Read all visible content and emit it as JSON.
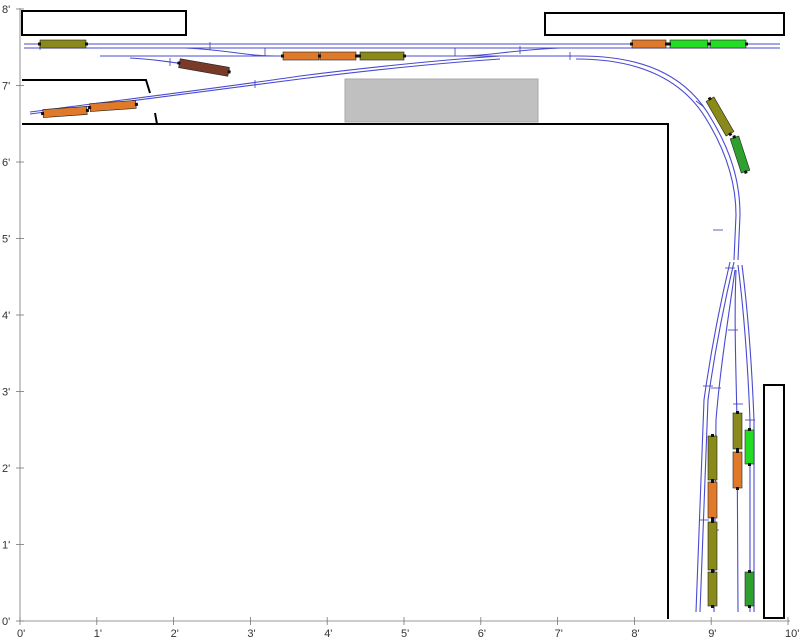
{
  "axes": {
    "x_labels": [
      "0'",
      "1'",
      "2'",
      "3'",
      "4'",
      "5'",
      "6'",
      "7'",
      "8'",
      "9'",
      "10'"
    ],
    "y_labels": [
      "0'",
      "1'",
      "2'",
      "3'",
      "4'",
      "5'",
      "6'",
      "7'",
      "8'"
    ]
  },
  "colors": {
    "track": "#4a4ad0",
    "bench": "#000000",
    "structure_fill": "#c0c0c0",
    "olive_car": "#8a8a1a",
    "orange_car": "#e07a2a",
    "green_car": "#22dd22",
    "dark_green_car": "#2ea02e",
    "brown_car": "#7a3a2a"
  },
  "rolling_stock": [
    {
      "id": "car-1",
      "kind": "olive_car"
    },
    {
      "id": "car-2",
      "kind": "brown_car"
    },
    {
      "id": "car-3",
      "kind": "orange_car"
    },
    {
      "id": "car-4",
      "kind": "orange_car"
    },
    {
      "id": "car-5",
      "kind": "olive_car"
    },
    {
      "id": "car-6",
      "kind": "orange_car"
    },
    {
      "id": "car-7",
      "kind": "green_car"
    },
    {
      "id": "car-8",
      "kind": "green_car"
    },
    {
      "id": "car-9",
      "kind": "green_car"
    },
    {
      "id": "car-10",
      "kind": "orange_car"
    },
    {
      "id": "car-11",
      "kind": "orange_car"
    },
    {
      "id": "car-12",
      "kind": "olive_car"
    },
    {
      "id": "car-13",
      "kind": "dark_green_car"
    },
    {
      "id": "car-14",
      "kind": "olive_car"
    },
    {
      "id": "car-15",
      "kind": "orange_car"
    },
    {
      "id": "car-16",
      "kind": "orange_car"
    },
    {
      "id": "car-17",
      "kind": "olive_car"
    },
    {
      "id": "car-18",
      "kind": "olive_car"
    },
    {
      "id": "car-19",
      "kind": "olive_car"
    },
    {
      "id": "car-20",
      "kind": "orange_car"
    },
    {
      "id": "car-21",
      "kind": "green_car"
    },
    {
      "id": "car-22",
      "kind": "dark_green_car"
    }
  ]
}
